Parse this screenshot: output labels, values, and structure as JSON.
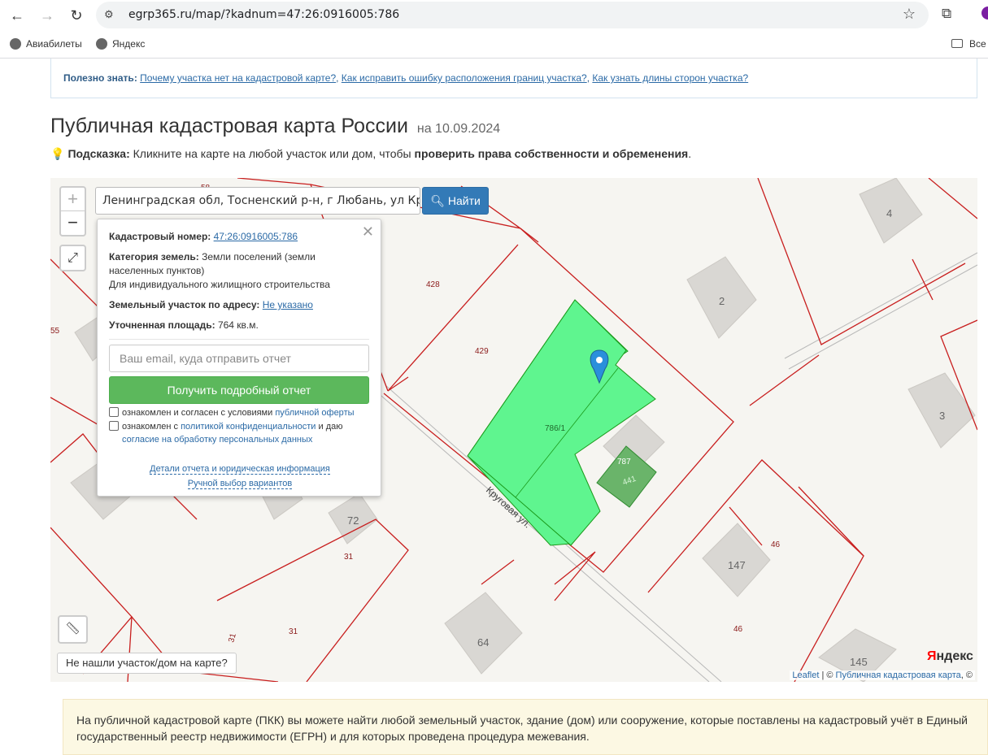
{
  "browser": {
    "url": "egrp365.ru/map/?kadnum=47:26:0916005:786",
    "bookmarks": [
      "Авиабилеты",
      "Яндекс"
    ],
    "bookmarks_all": "Все"
  },
  "useful": {
    "label": "Полезно знать:",
    "links": [
      "Почему участка нет на кадастровой карте?",
      "Как исправить ошибку расположения границ участка?",
      "Как узнать длины сторон участка?"
    ]
  },
  "page": {
    "title": "Публичная кадастровая карта России",
    "date": "на 10.09.2024",
    "hint_label": "Подсказка:",
    "hint_text": "Кликните на карте на любой участок или дом, чтобы",
    "hint_bold": "проверить права собственности и обременения",
    "hint_end": "."
  },
  "map": {
    "zoom_in": "+",
    "zoom_out": "−",
    "search_value": "Ленинградская обл, Тосненский р-н, г Любань, ул Круговая,",
    "search_button": "Найти",
    "street": "Круговая ул.",
    "labels": {
      "l428": "428",
      "l429": "429",
      "l55": "55",
      "l786": "786/1",
      "l787": "787",
      "l441": "441",
      "h4": "4",
      "h2": "2",
      "h3": "3",
      "h72": "72",
      "h147": "147",
      "h64": "64",
      "h145": "145",
      "l31a": "31",
      "l31b": "31",
      "l31c": "31",
      "l46a": "46",
      "l46b": "46",
      "l58": "58"
    },
    "not_found": "Не нашли участок/дом на карте?",
    "yandex_logo": "Яндекс",
    "attribution_leaflet": "Leaflet",
    "attribution_sep": "| ©",
    "attribution_pkk": "Публичная кадастровая карта",
    "attribution_end": ", ©"
  },
  "popup": {
    "cadnum_label": "Кадастровый номер:",
    "cadnum": "47:26:0916005:786",
    "category_label": "Категория земель:",
    "category_text": "Земли поселений (земли населенных пунктов)",
    "usage": "Для индивидуального жилищного строительства",
    "address_label": "Земельный участок по адресу:",
    "address": "Не указано",
    "area_label": "Уточненная площадь:",
    "area": "764 кв.м.",
    "email_placeholder": "Ваш email, куда отправить отчет",
    "get_report": "Получить подробный отчет",
    "check1_text": "ознакомлен и согласен с условиями",
    "check1_link": "публичной оферты",
    "check2_text": "ознакомлен с",
    "check2_link": "политикой конфиденциальности",
    "check2_mid": "и даю",
    "check2_link2": "согласие на обработку персональных данных",
    "details_link": "Детали отчета и юридическая информация",
    "manual_link": "Ручной выбор вариантов"
  },
  "bottom_note": "На публичной кадастровой карте (ПКК) вы можете найти любой земельный участок, здание (дом) или сооружение, которые поставлены на кадастровый учёт в Единый государственный реестр недвижимости (ЕГРН) и для которых проведена процедура межевания.",
  "colors": {
    "parcel_highlight": "#5ff58f",
    "boundary": "#c81e1e",
    "search_button": "#337ab7",
    "report_button": "#5cb85c"
  }
}
